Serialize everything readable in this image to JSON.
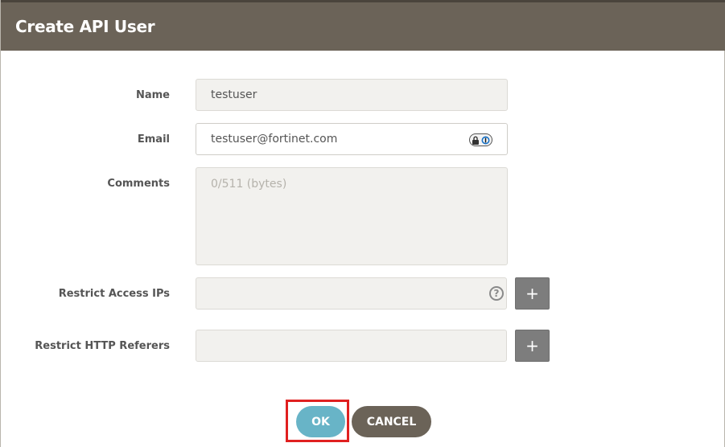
{
  "dialog": {
    "title": "Create API User"
  },
  "form": {
    "name": {
      "label": "Name",
      "value": "testuser"
    },
    "email": {
      "label": "Email",
      "value": "testuser@fortinet.com",
      "icon": "password-manager-lock-icon"
    },
    "comments": {
      "label": "Comments",
      "placeholder": "0/511 (bytes)"
    },
    "restrict_ips": {
      "label": "Restrict Access IPs",
      "value": "",
      "help_icon": "question-mark-icon",
      "add_symbol": "+"
    },
    "restrict_referers": {
      "label": "Restrict HTTP Referers",
      "value": "",
      "add_symbol": "+"
    }
  },
  "buttons": {
    "ok_label": "OK",
    "cancel_label": "CANCEL"
  },
  "colors": {
    "header": "#6b6358",
    "ok": "#68b4c7",
    "cancel": "#6b6358",
    "highlight": "#e02020"
  }
}
